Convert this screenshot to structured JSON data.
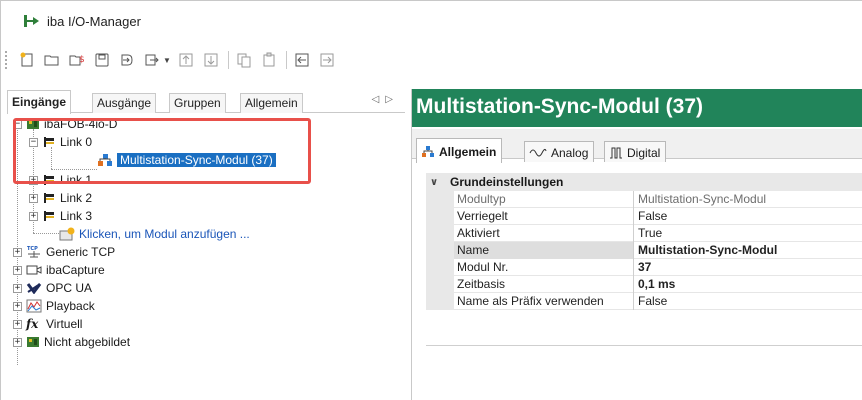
{
  "window": {
    "title": "iba I/O-Manager"
  },
  "toolbar": {
    "buttons": [
      {
        "icon": "new-icon"
      },
      {
        "icon": "open-folder-icon"
      },
      {
        "icon": "open-special-icon"
      },
      {
        "icon": "save-icon"
      },
      {
        "icon": "import-icon"
      },
      {
        "icon": "export-icon"
      },
      {
        "icon": "move-up-icon"
      },
      {
        "icon": "move-down-icon"
      },
      {
        "icon": "copy-icon"
      },
      {
        "icon": "paste-icon"
      },
      {
        "icon": "collapse-left-icon"
      },
      {
        "icon": "expand-right-icon"
      }
    ]
  },
  "left_tabs": [
    "Eingänge",
    "Ausgänge",
    "Gruppen",
    "Allgemein"
  ],
  "tab_nav": {
    "prev": "◁",
    "next": "▷"
  },
  "tree": {
    "root": "ibaFOB-4io-D",
    "link0": "Link 0",
    "selected_module": "Multistation-Sync-Modul (37)",
    "link1": "Link 1",
    "link2": "Link 2",
    "link3": "Link 3",
    "add_module": "Klicken, um Modul anzufügen ...",
    "generic_tcp": "Generic TCP",
    "ibacapture": "ibaCapture",
    "opcua": "OPC UA",
    "playback": "Playback",
    "virtuell": "Virtuell",
    "nicht_abgebildet": "Nicht abgebildet",
    "tcp_badge": "TCP",
    "fx_badge": "fx"
  },
  "module_header": "Multistation-Sync-Modul (37)",
  "right_tabs": [
    "Allgemein",
    "Analog",
    "Digital"
  ],
  "properties": {
    "group": "Grundeinstellungen",
    "rows": [
      {
        "name": "Modultyp",
        "value": "Multistation-Sync-Modul"
      },
      {
        "name": "Verriegelt",
        "value": "False"
      },
      {
        "name": "Aktiviert",
        "value": "True"
      },
      {
        "name": "Name",
        "value": "Multistation-Sync-Modul"
      },
      {
        "name": "Modul Nr.",
        "value": "37"
      },
      {
        "name": "Zeitbasis",
        "value": "0,1 ms"
      },
      {
        "name": "Name als Präfix verwenden",
        "value": "False"
      }
    ]
  },
  "colors": {
    "header_green": "#21845a",
    "selection_blue": "#1a6fc2",
    "highlight_red": "#e8504a",
    "link_blue": "#1a55b8"
  }
}
